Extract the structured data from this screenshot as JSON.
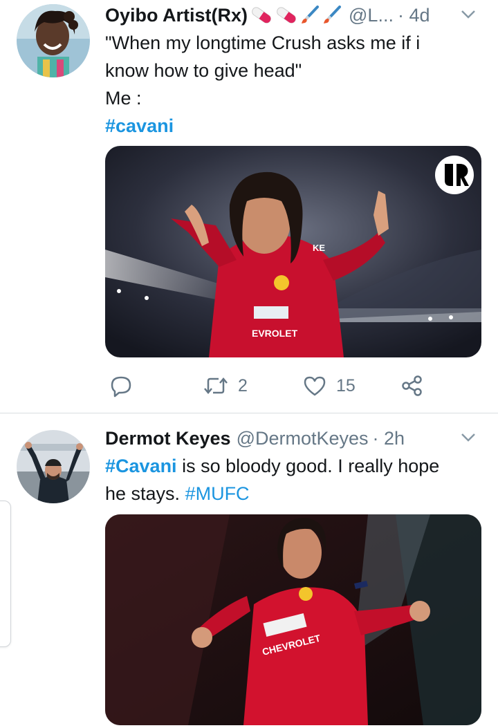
{
  "tweets": [
    {
      "author_name": "Oyibo Artist(Rx)",
      "emoji_icons": [
        "pill-icon",
        "pill-icon",
        "paintbrush-icon",
        "paintbrush-icon"
      ],
      "handle": "@L...",
      "time": "· 4d",
      "text_lines": [
        "\"When my longtime Crush asks me if i",
        "know how to give head\"",
        "Me :"
      ],
      "hashtag": "#cavani",
      "media_watermark": "UR logo",
      "media_text": [
        "KE",
        "EVROLET"
      ],
      "actions": {
        "reply_icon": "reply-icon",
        "retweet_icon": "retweet-icon",
        "retweet_count": "2",
        "like_icon": "heart-icon",
        "like_count": "15",
        "share_icon": "share-icon"
      }
    },
    {
      "author_name": "Dermot Keyes",
      "handle": "@DermotKeyes",
      "time": "· 2h",
      "text_hashtag_1": "#Cavani",
      "text_part_1": " is so bloody good. I really hope",
      "text_part_2": "he stays. ",
      "text_hashtag_2": "#MUFC",
      "media_text": "CHEVROLET"
    }
  ],
  "colors": {
    "link": "#1b95e0",
    "secondary_text": "#657786",
    "primary_text": "#14171a",
    "united_red": "#c8102e"
  }
}
